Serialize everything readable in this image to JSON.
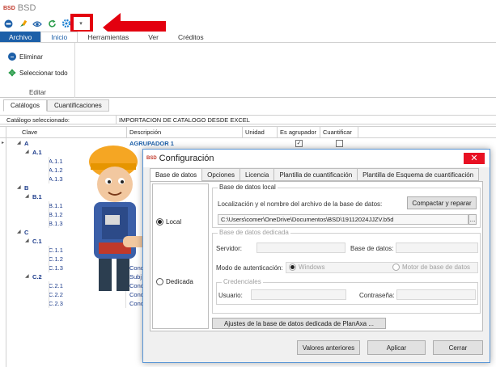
{
  "app": {
    "logo": "BSD",
    "title": "BSD"
  },
  "ribbon": {
    "tabs": [
      "Archivo",
      "Inicio",
      "Herramientas",
      "Ver",
      "Créditos"
    ],
    "group": {
      "label": "Editar",
      "buttons": [
        "Eliminar",
        "Seleccionar todo"
      ]
    }
  },
  "catalog_tabs": [
    "Catálogos",
    "Cuantificaciones"
  ],
  "selected_catalog": {
    "label": "Catálogo seleccionado:",
    "value": "IMPORTACION DE CATALOGO DESDE EXCEL"
  },
  "grid": {
    "headers": [
      "Clave",
      "Descripción",
      "Unidad",
      "Es agrupador",
      "Cuantificar"
    ],
    "rows": [
      {
        "code": "A",
        "level": 1,
        "desc": "AGRUPADOR 1",
        "grouper": true,
        "quantify": false
      },
      {
        "code": "A.1",
        "level": 2,
        "desc": ""
      },
      {
        "code": "A.1.1",
        "level": 3,
        "desc": ""
      },
      {
        "code": "A.1.2",
        "level": 3,
        "desc": ""
      },
      {
        "code": "A.1.3",
        "level": 3,
        "desc": ""
      },
      {
        "code": "B",
        "level": 1,
        "desc": ""
      },
      {
        "code": "B.1",
        "level": 2,
        "desc": ""
      },
      {
        "code": "B.1.1",
        "level": 3,
        "desc": ""
      },
      {
        "code": "B.1.2",
        "level": 3,
        "desc": ""
      },
      {
        "code": "B.1.3",
        "level": 3,
        "desc": ""
      },
      {
        "code": "C",
        "level": 1,
        "desc": ""
      },
      {
        "code": "C.1",
        "level": 2,
        "desc": ""
      },
      {
        "code": "C.1.1",
        "level": 3,
        "desc": ""
      },
      {
        "code": "C.1.2",
        "level": 3,
        "desc": ""
      },
      {
        "code": "C.1.3",
        "level": 3,
        "desc": "Conc"
      },
      {
        "code": "C.2",
        "level": 2,
        "desc": "Subj"
      },
      {
        "code": "C.2.1",
        "level": 3,
        "desc": "Conc"
      },
      {
        "code": "C.2.2",
        "level": 3,
        "desc": "Conc"
      },
      {
        "code": "C.2.3",
        "level": 3,
        "desc": "Conc"
      }
    ]
  },
  "dialog": {
    "logo": "BSD",
    "title": "Configuración",
    "close": "✕",
    "tabs": [
      "Base de datos",
      "Opciones",
      "Licencia",
      "Plantilla de cuantificación",
      "Plantilla de Esquema de cuantificación"
    ],
    "radio_local": "Local",
    "radio_dedicated": "Dedicada",
    "local": {
      "legend": "Base de datos local",
      "location_label": "Localización y el nombre del archivo de la base de datos:",
      "compact_button": "Compactar y reparar",
      "path": "C:\\Users\\comer\\OneDrive\\Documentos\\BSD\\19112024JJZV.b5d",
      "browse": "..."
    },
    "dedicated": {
      "legend": "Base de datos dedicada",
      "server_label": "Servidor:",
      "db_label": "Base de datos:",
      "auth_label": "Modo de autenticación:",
      "auth_windows": "Windows",
      "auth_engine": "Motor de base de datos",
      "credentials_legend": "Credenciales",
      "user_label": "Usuario:",
      "password_label": "Contraseña:"
    },
    "planaxa_button": "Ajustes de la base de datos dedicada de PlanAxa ...",
    "footer": {
      "previous": "Valores anteriores",
      "apply": "Aplicar",
      "close": "Cerrar"
    }
  },
  "colors": {
    "accent": "#1c5fa8",
    "annotation_red": "#e3000f",
    "close_red": "#e81123"
  }
}
